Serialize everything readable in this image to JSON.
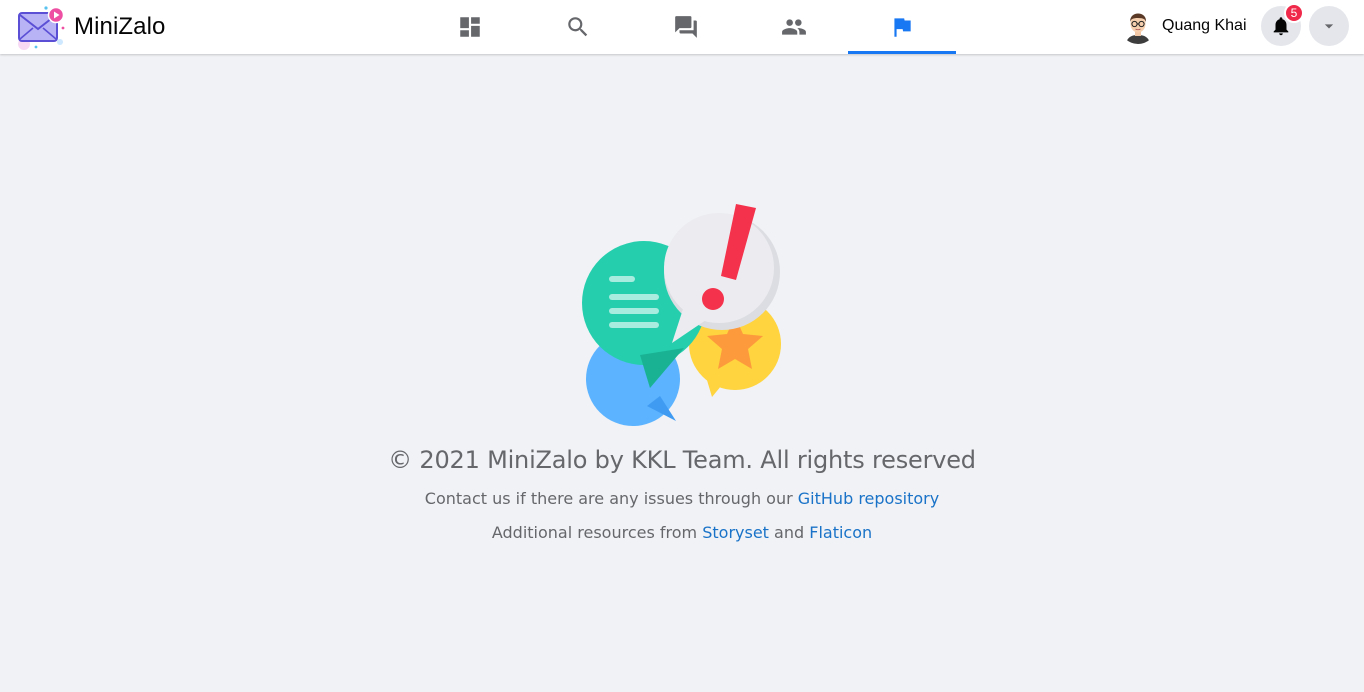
{
  "app": {
    "name": "MiniZalo"
  },
  "nav": {
    "tabs": [
      {
        "key": "dashboard",
        "icon": "dashboard-icon",
        "active": false
      },
      {
        "key": "search",
        "icon": "search-icon",
        "active": false
      },
      {
        "key": "messages",
        "icon": "chat-bubbles-icon",
        "active": false
      },
      {
        "key": "friends",
        "icon": "people-icon",
        "active": false
      },
      {
        "key": "about",
        "icon": "flag-icon",
        "active": true
      }
    ]
  },
  "user": {
    "name": "Quang Khai",
    "avatar_icon": "user-avatar"
  },
  "notifications": {
    "count": "5",
    "icon": "bell-icon"
  },
  "account_menu": {
    "icon": "caret-down-icon"
  },
  "footer": {
    "copyright": "© 2021 MiniZalo by KKL Team. All rights reserved",
    "contact_text": "Contact us if there are any issues through our",
    "contact_link": "GitHub repository",
    "resources_text": "Additional resources from",
    "resources_link_1": "Storyset",
    "resources_and": "and",
    "resources_link_2": "Flaticon"
  },
  "colors": {
    "accent": "#1877f2",
    "icon_gray": "#65676b",
    "badge": "#f02849",
    "link": "#1a73c8",
    "background": "#f0f2f5"
  }
}
